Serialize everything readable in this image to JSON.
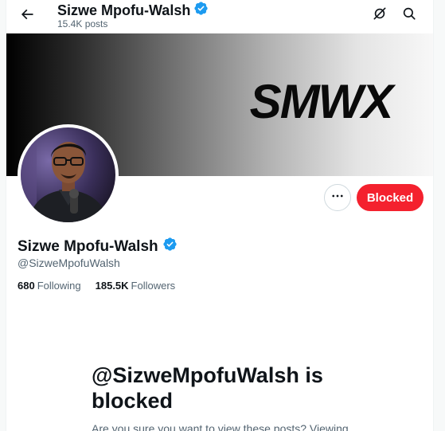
{
  "header": {
    "name": "Sizwe Mpofu-Walsh",
    "posts": "15.4K posts"
  },
  "banner": {
    "logo_text": "SMWX"
  },
  "profile": {
    "name": "Sizwe Mpofu-Walsh",
    "handle": "@SizweMpofuWalsh",
    "following_count": "680",
    "following_label": "Following",
    "followers_count": "185.5K",
    "followers_label": "Followers"
  },
  "actions": {
    "blocked_label": "Blocked"
  },
  "notice": {
    "title": "@SizweMpofuWalsh is blocked",
    "subtitle": "Are you sure you want to view these posts? Viewing"
  },
  "icons": {
    "back": "arrow-left-icon",
    "grok": "grok-icon",
    "search": "search-icon",
    "verified": "verified-badge-icon",
    "more": "more-dots-icon"
  },
  "colors": {
    "verified": "#1d9bf0",
    "blocked": "#f4212e",
    "secondary_text": "#536471"
  }
}
